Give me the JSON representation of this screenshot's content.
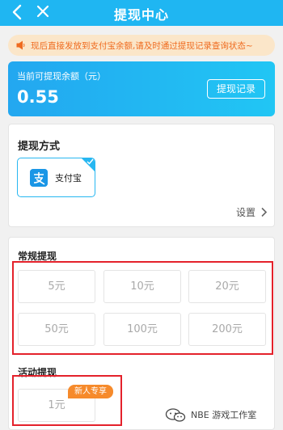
{
  "header": {
    "title": "提现中心"
  },
  "notice": {
    "text": "现后直接发放到支付宝余额,请及时通过提现记录查询状态~"
  },
  "balance": {
    "label": "当前可提现余额（元）",
    "amount": "0.55",
    "record_button": "提现记录"
  },
  "method": {
    "title": "提现方式",
    "selected_option": "支付宝",
    "settings_label": "设置"
  },
  "regular": {
    "title": "常规提现",
    "amounts": [
      "5元",
      "10元",
      "20元",
      "50元",
      "100元",
      "200元"
    ]
  },
  "activity": {
    "title": "活动提现",
    "amounts": [
      "1元"
    ],
    "badge": "新人专享"
  },
  "watermark": {
    "text": "NBE 游戏工作室"
  },
  "colors": {
    "primary": "#1fb6f2",
    "notice_bg": "#fbe6c9",
    "notice_text": "#ef6b1f",
    "highlight_red": "#e4212b",
    "badge_orange": "#f68a2b"
  }
}
